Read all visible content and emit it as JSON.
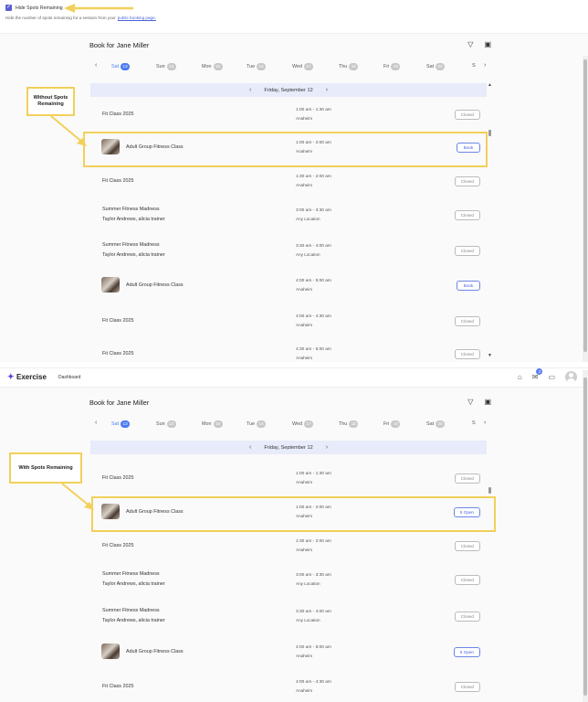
{
  "setting": {
    "checkbox_label": "Hide Spots Remaining",
    "description_prefix": "Hide the number of spots remaining for a session from your",
    "description_link": "public booking page.",
    "checked": true
  },
  "navbar": {
    "brand": "Exercise",
    "dashboard": "Dashboard",
    "mail_badge": "3"
  },
  "booking": {
    "title": "Book for Jane Miller",
    "days": [
      {
        "label": "Sat",
        "num": "13",
        "selected": true
      },
      {
        "label": "Sun",
        "num": "14"
      },
      {
        "label": "Mon",
        "num": "15"
      },
      {
        "label": "Tue",
        "num": "16"
      },
      {
        "label": "Wed",
        "num": "17"
      },
      {
        "label": "Thu",
        "num": "18"
      },
      {
        "label": "Fri",
        "num": "19"
      },
      {
        "label": "Sat",
        "num": "20"
      },
      {
        "label": "S",
        "num": ""
      }
    ],
    "date_label": "Friday, September 12"
  },
  "panel1": {
    "callout": "Without Spots Remaining",
    "items": [
      {
        "name": "Fit Class 2025",
        "time": "1:00 am - 1:30 am",
        "loc": "Anaheim",
        "btn": "Closed",
        "thumb": false
      },
      {
        "name": "Adult Group Fitness Class",
        "time": "1:00 am - 2:00 am",
        "loc": "Anaheim",
        "btn": "Book",
        "thumb": true
      },
      {
        "name": "Fit Class 2025",
        "time": "1:30 am - 2:00 am",
        "loc": "Anaheim",
        "btn": "Closed",
        "thumb": false
      },
      {
        "name": "Summer Fitness Madness",
        "name2": "Taylor Andrews, alicia trainer",
        "time": "3:00 am - 3:30 am",
        "loc": "Any Location",
        "btn": "Closed",
        "thumb": false
      },
      {
        "name": "Summer Fitness Madness",
        "name2": "Taylor Andrews, alicia trainer",
        "time": "3:30 am - 4:00 am",
        "loc": "Any Location",
        "btn": "Closed",
        "thumb": false
      },
      {
        "name": "Adult Group Fitness Class",
        "time": "4:00 am - 5:00 am",
        "loc": "Anaheim",
        "btn": "Book",
        "thumb": true
      },
      {
        "name": "Fit Class 2025",
        "time": "4:00 am - 4:30 am",
        "loc": "Anaheim",
        "btn": "Closed",
        "thumb": false
      },
      {
        "name": "Fit Class 2025",
        "time": "4:30 am - 5:00 am",
        "loc": "Anaheim",
        "btn": "Closed",
        "thumb": false
      }
    ]
  },
  "panel2": {
    "callout": "With Spots Remaining",
    "items": [
      {
        "name": "Fit Class 2025",
        "time": "1:00 am - 1:30 am",
        "loc": "Anaheim",
        "btn": "Closed",
        "thumb": false
      },
      {
        "name": "Adult Group Fitness Class",
        "time": "1:00 am - 2:00 am",
        "loc": "Anaheim",
        "btn": "5 Open",
        "thumb": true
      },
      {
        "name": "Fit Class 2025",
        "time": "1:30 am - 2:00 am",
        "loc": "Anaheim",
        "btn": "Closed",
        "thumb": false
      },
      {
        "name": "Summer Fitness Madness",
        "name2": "Taylor Andrews, alicia trainer",
        "time": "3:00 am - 3:30 am",
        "loc": "Any Location",
        "btn": "Closed",
        "thumb": false
      },
      {
        "name": "Summer Fitness Madness",
        "name2": "Taylor Andrews, alicia trainer",
        "time": "3:30 am - 4:00 am",
        "loc": "Any Location",
        "btn": "Closed",
        "thumb": false
      },
      {
        "name": "Adult Group Fitness Class",
        "time": "4:00 am - 5:00 am",
        "loc": "Anaheim",
        "btn": "5 Open",
        "thumb": true
      },
      {
        "name": "Fit Class 2025",
        "time": "4:00 am - 4:30 am",
        "loc": "Anaheim",
        "btn": "Closed",
        "thumb": false
      }
    ]
  },
  "colors": {
    "accent": "#4b7bf0",
    "highlight": "#f2d05a",
    "date_bar": "#e8ebfa"
  }
}
